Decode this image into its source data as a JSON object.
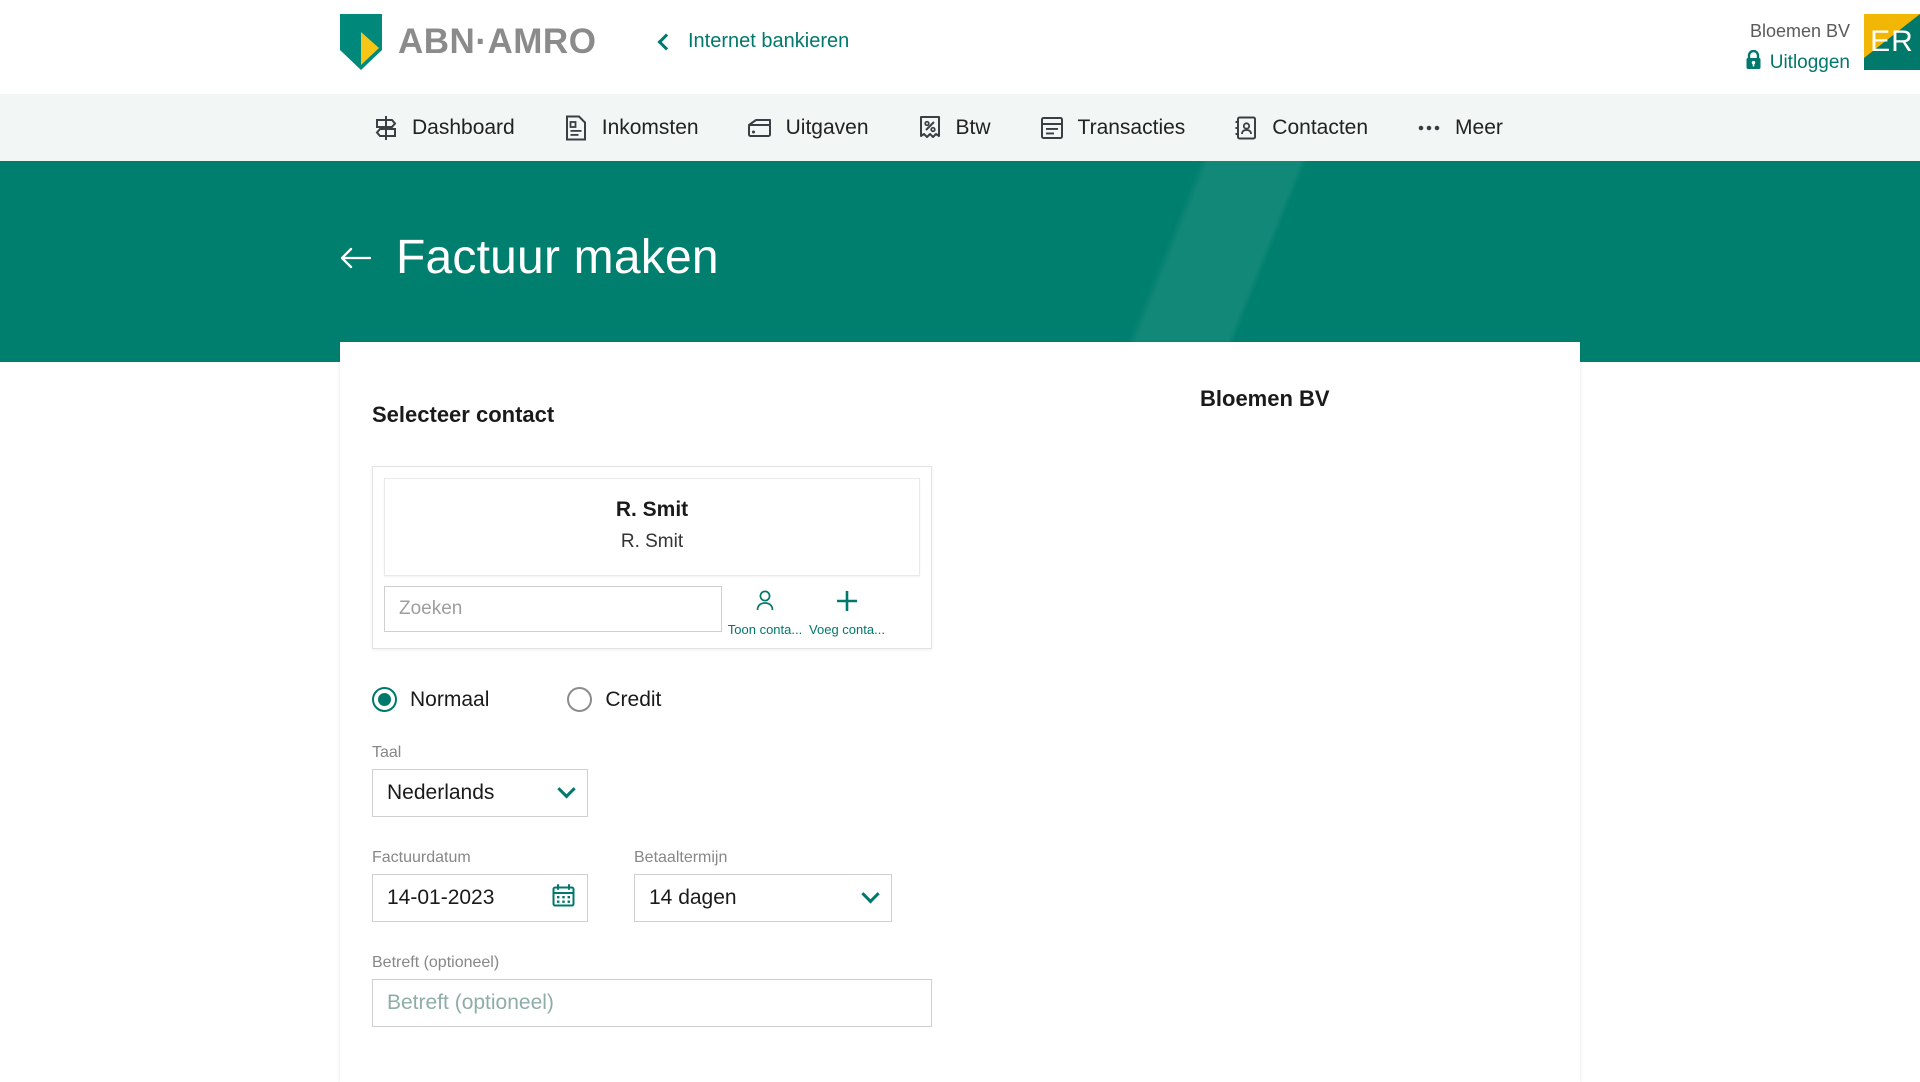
{
  "brand": {
    "wordmark": "ABN·AMRO",
    "logo_icon": "abn-amro-shield-logo",
    "shield_green": "#00796B",
    "shield_yellow": "#F2B705"
  },
  "header": {
    "internet_banking_link": "Internet bankieren",
    "back_chevron_icon": "chevron-left-icon",
    "user_company": "Bloemen BV",
    "logout_label": "Uitloggen",
    "lock_icon": "lock-icon",
    "avatar_initials": "ER"
  },
  "nav": {
    "items": [
      {
        "label": "Dashboard",
        "icon": "signpost-icon"
      },
      {
        "label": "Inkomsten",
        "icon": "document-lines-icon"
      },
      {
        "label": "Uitgaven",
        "icon": "wallet-card-icon"
      },
      {
        "label": "Btw",
        "icon": "receipt-percent-icon"
      },
      {
        "label": "Transacties",
        "icon": "transaction-document-icon"
      },
      {
        "label": "Contacten",
        "icon": "contact-book-icon"
      },
      {
        "label": "Meer",
        "icon": "ellipsis-icon"
      }
    ]
  },
  "hero": {
    "title": "Factuur maken",
    "back_arrow_icon": "arrow-left-icon",
    "background_color": "#007F6E"
  },
  "panel": {
    "company_name": "Bloemen BV",
    "section_title": "Selecteer contact",
    "contact": {
      "name": "R. Smit",
      "subtitle": "R. Smit",
      "search_placeholder": "Zoeken",
      "search_value": "",
      "show_contact_label": "Toon conta...",
      "show_contact_icon": "person-icon",
      "add_contact_label": "Voeg conta...",
      "add_contact_icon": "plus-icon"
    },
    "invoice_type": {
      "options": [
        {
          "label": "Normaal",
          "selected": true
        },
        {
          "label": "Credit",
          "selected": false
        }
      ]
    },
    "language": {
      "label": "Taal",
      "value": "Nederlands",
      "chevron_icon": "chevron-down-icon"
    },
    "invoice_date": {
      "label": "Factuurdatum",
      "value": "14-01-2023",
      "calendar_icon": "calendar-icon"
    },
    "payment_term": {
      "label": "Betaaltermijn",
      "value": "14 dagen",
      "chevron_icon": "chevron-down-icon"
    },
    "subject": {
      "label": "Betreft (optioneel)",
      "placeholder": "Betreft (optioneel)",
      "value": ""
    }
  },
  "colors": {
    "accent_green": "#00786B",
    "hero_green": "#007F6E",
    "nav_background": "#F2F7F6",
    "yellow": "#F2B705"
  }
}
